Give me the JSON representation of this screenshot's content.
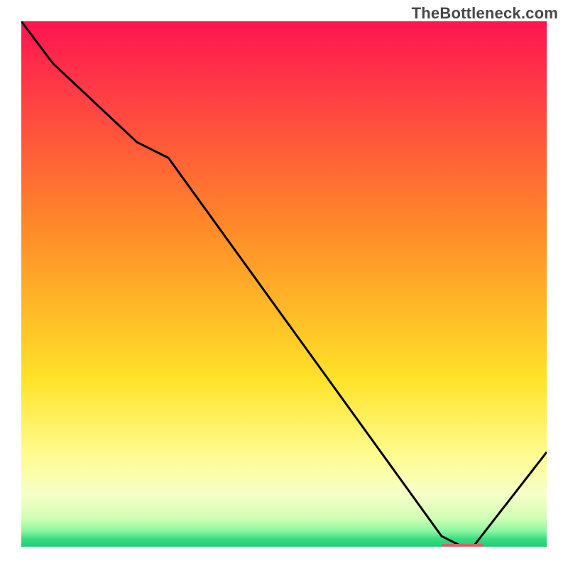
{
  "watermark": "TheBottleneck.com",
  "chart_data": {
    "type": "line",
    "title": "",
    "xlabel": "",
    "ylabel": "",
    "xlim": [
      0,
      100
    ],
    "ylim": [
      0,
      100
    ],
    "x": [
      0,
      6,
      22,
      28,
      80,
      84,
      86,
      100
    ],
    "values": [
      100,
      92,
      77,
      74,
      2,
      0,
      0,
      18
    ],
    "marker_region": {
      "x0": 80,
      "x1": 88,
      "y": 0
    },
    "gradient_stops": [
      {
        "offset": 0.0,
        "color": "#ff1452"
      },
      {
        "offset": 0.4,
        "color": "#ff8c28"
      },
      {
        "offset": 0.68,
        "color": "#ffe228"
      },
      {
        "offset": 0.82,
        "color": "#fffb8c"
      },
      {
        "offset": 0.9,
        "color": "#f7ffc8"
      },
      {
        "offset": 0.945,
        "color": "#d2ffb4"
      },
      {
        "offset": 0.97,
        "color": "#8cf7a0"
      },
      {
        "offset": 0.985,
        "color": "#3cdc82"
      },
      {
        "offset": 1.0,
        "color": "#1ecd78"
      }
    ],
    "curve_color": "#000000",
    "marker_color": "#d26464"
  }
}
